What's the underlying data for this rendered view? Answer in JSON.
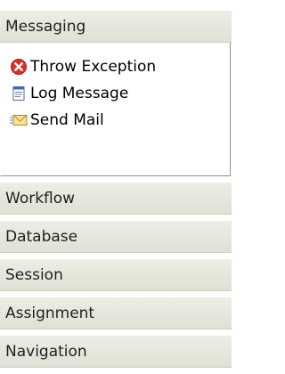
{
  "palette": {
    "drawers": [
      {
        "label": "Messaging",
        "expanded": true
      },
      {
        "label": "Workflow",
        "expanded": false
      },
      {
        "label": "Database",
        "expanded": false
      },
      {
        "label": "Session",
        "expanded": false
      },
      {
        "label": "Assignment",
        "expanded": false
      },
      {
        "label": "Navigation",
        "expanded": false
      }
    ],
    "messaging_tools": [
      {
        "label": "Throw Exception",
        "icon": "error-icon",
        "color": "#d9322b"
      },
      {
        "label": "Log Message",
        "icon": "log-message-icon",
        "color": "#3b6db5"
      },
      {
        "label": "Send Mail",
        "icon": "mail-icon",
        "color": "#d8a42c"
      }
    ]
  }
}
